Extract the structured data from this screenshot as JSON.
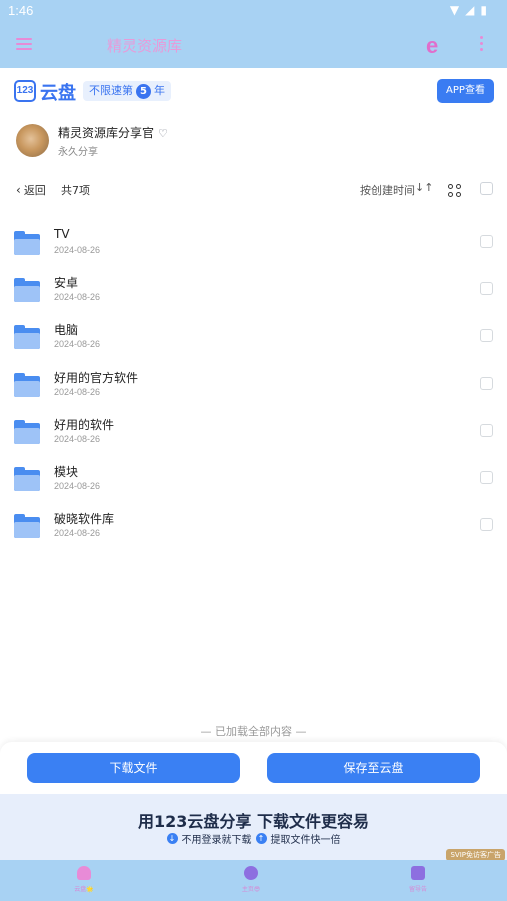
{
  "status_bar": {
    "time": "1:46",
    "icons": [
      "wifi-icon",
      "signal-icon",
      "battery-icon"
    ]
  },
  "app_bar": {
    "title": "精灵资源库",
    "accent_color": "#e78bd6",
    "background": "#a8d2f3"
  },
  "brand": {
    "logo_digits": "123",
    "logo_text": "云盘",
    "speed_badge_prefix": "不限速第",
    "speed_badge_number": "5",
    "speed_badge_suffix": "年",
    "app_view_button": "APP查看"
  },
  "sharer": {
    "name": "精灵资源库分享官",
    "subtitle": "永久分享"
  },
  "toolbar": {
    "back_label": "返回",
    "count_label": "共7项",
    "sort_label": "按创建时间"
  },
  "files": [
    {
      "name": "TV",
      "date": "2024-08-26"
    },
    {
      "name": "安卓",
      "date": "2024-08-26"
    },
    {
      "name": "电脑",
      "date": "2024-08-26"
    },
    {
      "name": "好用的官方软件",
      "date": "2024-08-26"
    },
    {
      "name": "好用的软件",
      "date": "2024-08-26"
    },
    {
      "name": "模块",
      "date": "2024-08-26"
    },
    {
      "name": "破晓软件库",
      "date": "2024-08-26"
    }
  ],
  "footer_note": "— 已加载全部内容 —",
  "actions": {
    "download": "下载文件",
    "save": "保存至云盘"
  },
  "promo": {
    "title": "用123云盘分享  下载文件更容易",
    "point_1": "不用登录就下载",
    "point_2": "提取文件快一倍",
    "ad_tag": "SVIP免访客广告"
  },
  "bottom_nav": [
    {
      "label": "云盘🌟",
      "icon": "cloud-icon"
    },
    {
      "label": "主页😎",
      "icon": "home-icon"
    },
    {
      "label": "留导告",
      "icon": "profile-icon"
    }
  ]
}
